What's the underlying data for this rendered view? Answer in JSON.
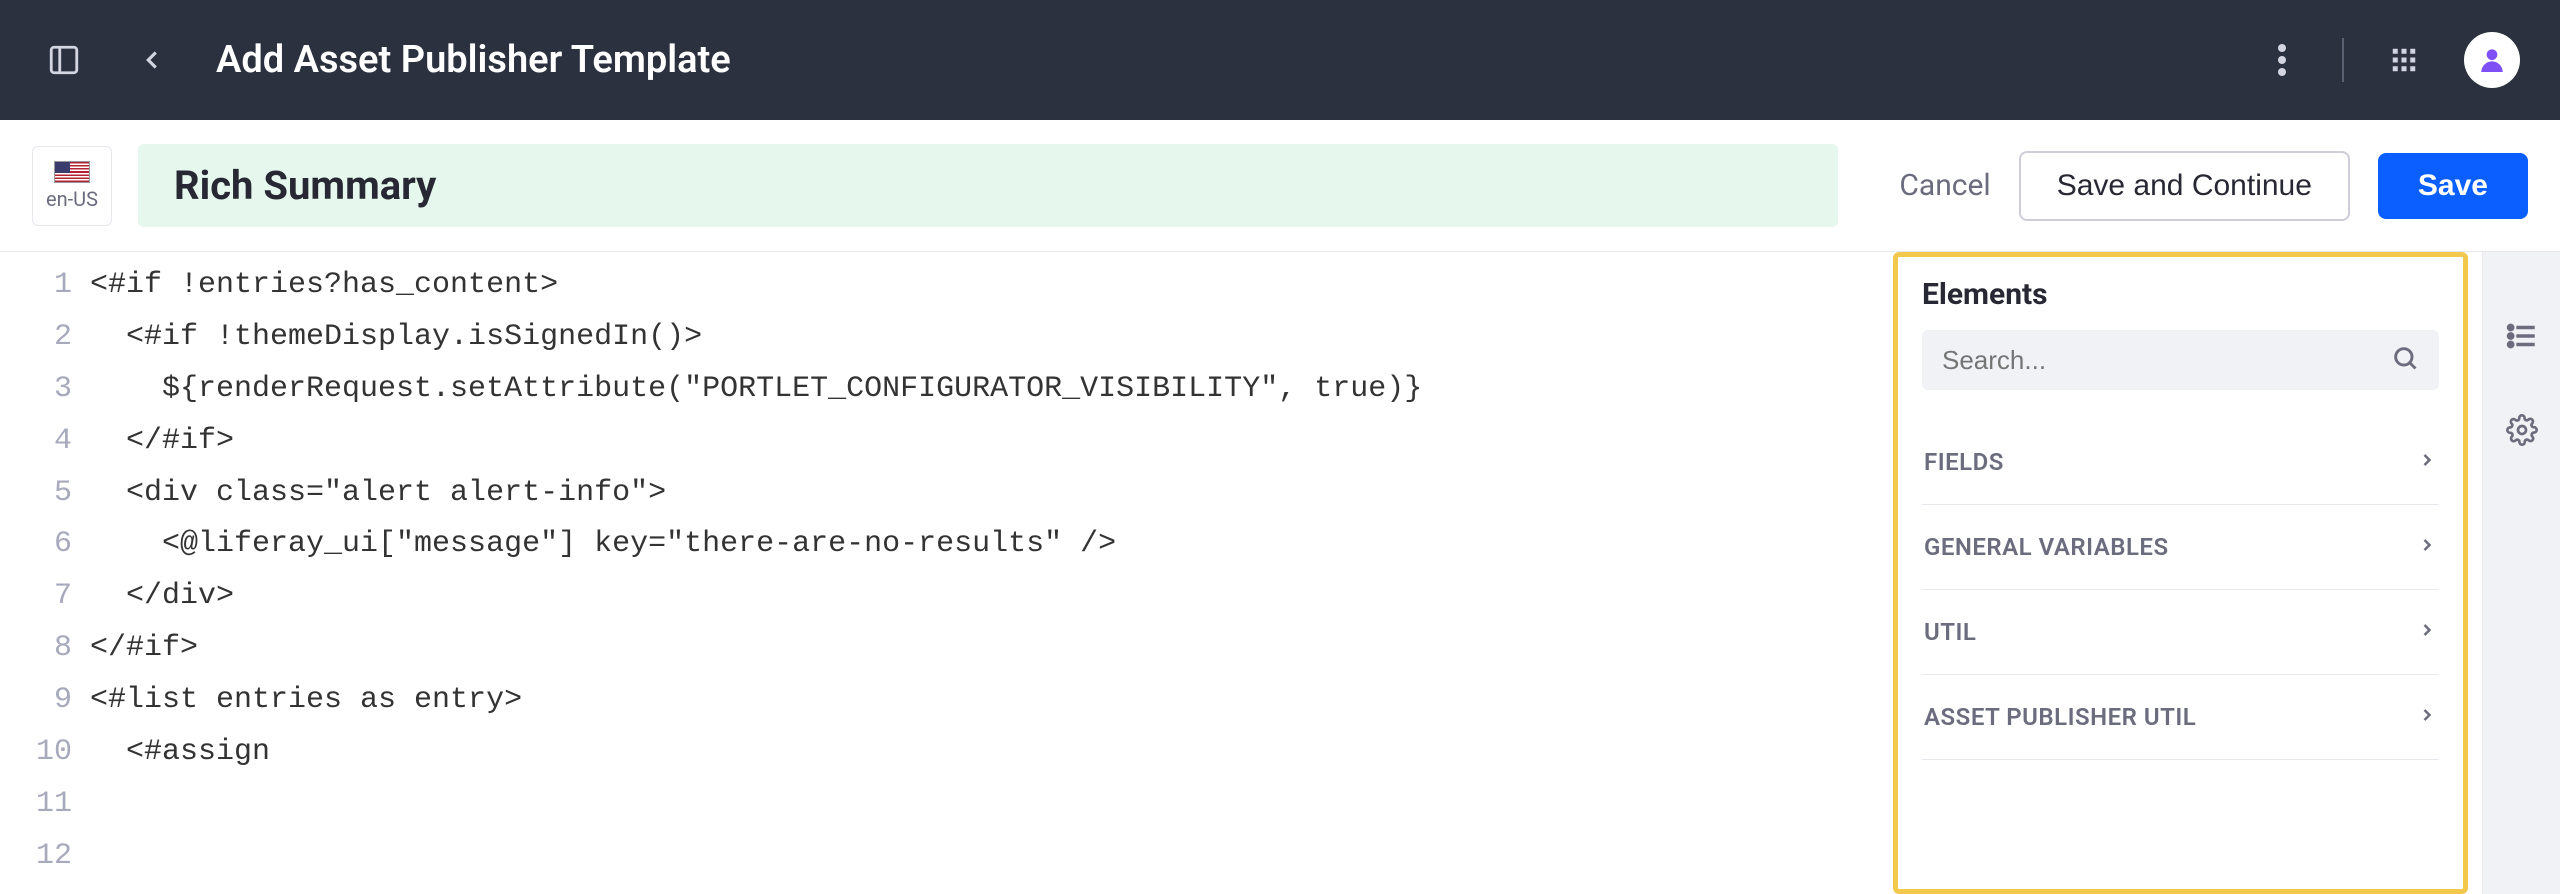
{
  "header": {
    "title": "Add Asset Publisher Template"
  },
  "locale": {
    "code": "en-US"
  },
  "template_title": "Rich Summary",
  "actions": {
    "cancel": "Cancel",
    "save_continue": "Save and Continue",
    "save": "Save"
  },
  "editor": {
    "lines": [
      "<#if !entries?has_content>",
      "  <#if !themeDisplay.isSignedIn()>",
      "    ${renderRequest.setAttribute(\"PORTLET_CONFIGURATOR_VISIBILITY\", true)}",
      "  </#if>",
      "",
      "  <div class=\"alert alert-info\">",
      "    <@liferay_ui[\"message\"] key=\"there-are-no-results\" />",
      "  </div>",
      "</#if>",
      "",
      "<#list entries as entry>",
      "  <#assign"
    ]
  },
  "elements_panel": {
    "title": "Elements",
    "search_placeholder": "Search...",
    "sections": [
      "FIELDS",
      "GENERAL VARIABLES",
      "UTIL",
      "ASSET PUBLISHER UTIL"
    ]
  },
  "line_numbers": [
    "1",
    "2",
    "3",
    "4",
    "5",
    "6",
    "7",
    "8",
    "9",
    "10",
    "11",
    "12"
  ]
}
